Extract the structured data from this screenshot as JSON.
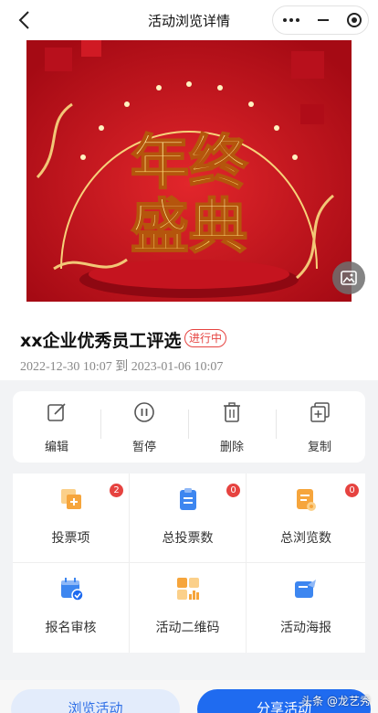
{
  "header": {
    "title": "活动浏览详情",
    "back_icon": "chevron-left-icon",
    "capsule_icons": [
      "more-dots-icon",
      "minimize-icon",
      "close-target-icon"
    ]
  },
  "banner": {
    "line1": "年终",
    "line2": "盛典",
    "image_icon": "image-icon",
    "colors": {
      "background": "#c8101c",
      "text": "#ffe27a"
    }
  },
  "activity": {
    "title": "xx企业优秀员工评选",
    "status": "进行中",
    "time_range": "2022-12-30 10:07 到 2023-01-06 10:07"
  },
  "actions": [
    {
      "label": "编辑",
      "icon": "edit-icon"
    },
    {
      "label": "暂停",
      "icon": "pause-icon"
    },
    {
      "label": "删除",
      "icon": "trash-icon"
    },
    {
      "label": "复制",
      "icon": "copy-icon"
    }
  ],
  "stats": [
    {
      "label": "投票项",
      "count": "2",
      "icon": "vote-item-icon"
    },
    {
      "label": "总投票数",
      "count": "0",
      "icon": "clipboard-icon"
    },
    {
      "label": "总浏览数",
      "count": "0",
      "icon": "document-icon"
    },
    {
      "label": "报名审核",
      "icon": "calendar-check-icon"
    },
    {
      "label": "活动二维码",
      "icon": "qr-code-icon"
    },
    {
      "label": "活动海报",
      "icon": "poster-share-icon"
    }
  ],
  "buttons": {
    "browse": "浏览活动",
    "share": "分享活动"
  },
  "watermark": "头条 @龙艺秀",
  "colors": {
    "accent": "#1f6bf0",
    "badge": "#e64340",
    "orange": "#f6a53c",
    "blue": "#3d86f0"
  }
}
